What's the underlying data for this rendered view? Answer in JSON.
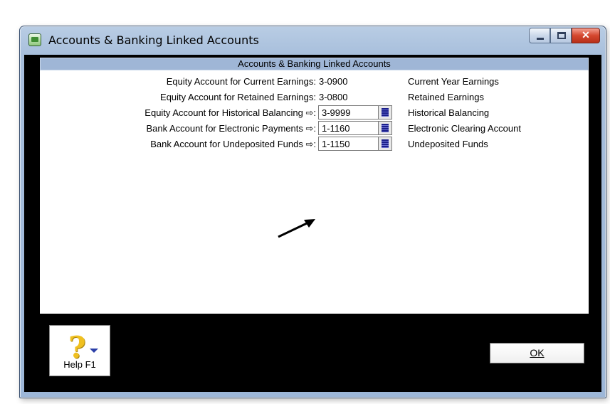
{
  "window": {
    "title": "Accounts & Banking Linked Accounts",
    "buttons": {
      "minimize": "minimize",
      "maximize": "maximize",
      "close": "✕"
    }
  },
  "panel": {
    "header": "Accounts & Banking Linked Accounts",
    "rows": [
      {
        "label": "Equity Account for Current Earnings:",
        "value": "3-0900",
        "desc": "Current Year Earnings",
        "editable": false
      },
      {
        "label": "Equity Account for Retained Earnings:",
        "value": "3-0800",
        "desc": "Retained Earnings",
        "editable": false
      },
      {
        "label": "Equity Account for Historical Balancing",
        "value": "3-9999",
        "desc": "Historical Balancing",
        "editable": true
      },
      {
        "label": "Bank Account for Electronic Payments",
        "value": "1-1160",
        "desc": "Electronic Clearing Account",
        "editable": true
      },
      {
        "label": "Bank Account for Undeposited Funds",
        "value": "1-1150",
        "desc": "Undeposited Funds",
        "editable": true
      }
    ],
    "link_arrow": "⇨:"
  },
  "footer": {
    "help_label": "Help F1",
    "help_icon": "?",
    "ok_label": "OK"
  },
  "icons": {
    "app": "app-icon",
    "lookup": "list-lookup-icon",
    "annotation": "pointer-arrow"
  }
}
